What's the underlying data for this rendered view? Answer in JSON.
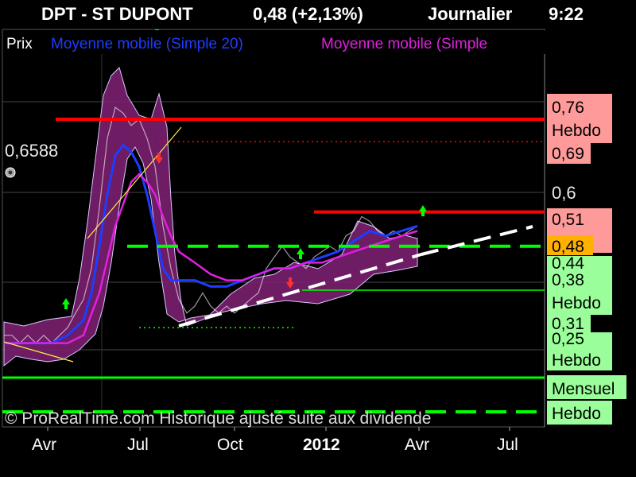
{
  "header": {
    "ticker": "DPT - ST DUPONT",
    "quote": "0,48 (+2,13%)",
    "period": "Journalier",
    "time": "9:22"
  },
  "legend": {
    "price": "Prix",
    "ma1": "Moyenne mobile (Simple 20)",
    "ma2": "Moyenne mobile (Simple"
  },
  "copyright": "© ProRealTime.com Historique ajusté suite aux dividende",
  "cursor_value": "0,6588",
  "colors": {
    "background": "#000000",
    "price_band": "#7a1f6e",
    "ma20": "#1e3cff",
    "ma_magenta": "#e020e0",
    "resistance": "#ff0000",
    "support": "#00ff00",
    "trend": "#ffffff",
    "label_red": "#ff9a9a",
    "label_green": "#9aff9a",
    "label_orange": "#ffb000"
  },
  "chart_data": {
    "type": "line",
    "title": "DPT - ST DUPONT",
    "x_ticks": [
      "Avr",
      "Jul",
      "Oct",
      "2012",
      "Avr",
      "Jul"
    ],
    "y_ticks": [
      "0,6"
    ],
    "y_range": [
      0.2,
      0.9
    ],
    "y_scale": "log",
    "series": [
      {
        "name": "Prix",
        "color": "#ffffff",
        "x": [
          0,
          10,
          20,
          30,
          40,
          50,
          60,
          70,
          80,
          90,
          100,
          110,
          120,
          130,
          140,
          150,
          160,
          170,
          180,
          190,
          200,
          210,
          220,
          230,
          240,
          250,
          260,
          270,
          280,
          290,
          300,
          310,
          320,
          330,
          340,
          350,
          360,
          370,
          380,
          390,
          400,
          410,
          420,
          430,
          440,
          450,
          460,
          470,
          480,
          490,
          500,
          510,
          520
        ],
        "values": [
          0.3,
          0.3,
          0.29,
          0.3,
          0.29,
          0.3,
          0.29,
          0.3,
          0.31,
          0.33,
          0.35,
          0.4,
          0.52,
          0.7,
          0.8,
          0.78,
          0.74,
          0.76,
          0.7,
          0.62,
          0.48,
          0.4,
          0.35,
          0.33,
          0.34,
          0.36,
          0.34,
          0.33,
          0.34,
          0.33,
          0.34,
          0.35,
          0.36,
          0.4,
          0.42,
          0.44,
          0.42,
          0.41,
          0.4,
          0.42,
          0.43,
          0.44,
          0.43,
          0.46,
          0.47,
          0.5,
          0.49,
          0.47,
          0.46,
          0.47,
          0.46,
          0.47,
          0.48
        ]
      },
      {
        "name": "Moyenne mobile (Simple 20)",
        "color": "#1e3cff",
        "x": [
          0,
          20,
          40,
          60,
          80,
          100,
          110,
          120,
          130,
          140,
          150,
          160,
          170,
          180,
          190,
          200,
          210,
          220,
          240,
          260,
          280,
          300,
          320,
          340,
          360,
          380,
          400,
          420,
          440,
          460,
          480,
          500,
          520
        ],
        "values": [
          0.29,
          0.29,
          0.29,
          0.29,
          0.3,
          0.32,
          0.36,
          0.44,
          0.55,
          0.65,
          0.68,
          0.66,
          0.62,
          0.55,
          0.47,
          0.4,
          0.38,
          0.38,
          0.38,
          0.37,
          0.37,
          0.38,
          0.39,
          0.4,
          0.4,
          0.41,
          0.42,
          0.43,
          0.45,
          0.47,
          0.46,
          0.47,
          0.48
        ]
      },
      {
        "name": "Moyenne mobile (Simple",
        "color": "#e020e0",
        "x": [
          0,
          20,
          40,
          60,
          80,
          100,
          120,
          140,
          160,
          170,
          180,
          190,
          200,
          210,
          220,
          240,
          260,
          280,
          300,
          320,
          340,
          360,
          380,
          400,
          420,
          440,
          460,
          480,
          500,
          520
        ],
        "values": [
          0.29,
          0.29,
          0.29,
          0.29,
          0.29,
          0.3,
          0.36,
          0.48,
          0.58,
          0.6,
          0.58,
          0.55,
          0.5,
          0.46,
          0.43,
          0.41,
          0.39,
          0.38,
          0.38,
          0.39,
          0.4,
          0.4,
          0.41,
          0.41,
          0.42,
          0.43,
          0.44,
          0.45,
          0.46,
          0.47
        ]
      }
    ],
    "price_labels": [
      {
        "value": "0,76",
        "note": "Hebdo",
        "color": "#ff9a9a"
      },
      {
        "value": "0,69",
        "color": "#ff9a9a"
      },
      {
        "value": "0,51",
        "color": "#ff9a9a"
      },
      {
        "value": "0,48",
        "color": "#ffb000"
      },
      {
        "value": "0,44",
        "color": "#9aff9a"
      },
      {
        "value": "0,38",
        "note": "Hebdo",
        "color": "#9aff9a"
      },
      {
        "value": "0,31",
        "color": "#9aff9a"
      },
      {
        "value": "0,25",
        "note": "Hebdo",
        "color": "#9aff9a"
      },
      {
        "note": "Mensuel",
        "color": "#9aff9a"
      },
      {
        "note": "Hebdo",
        "color": "#9aff9a"
      }
    ],
    "levels": [
      {
        "value": 0.76,
        "kind": "resistance",
        "style": "solid"
      },
      {
        "value": 0.69,
        "kind": "resistance",
        "style": "dotted"
      },
      {
        "value": 0.51,
        "kind": "resistance",
        "style": "solid"
      },
      {
        "value": 0.44,
        "kind": "support",
        "style": "dashed"
      },
      {
        "value": 0.38,
        "kind": "support",
        "style": "solid"
      },
      {
        "value": 0.31,
        "kind": "support",
        "style": "dotted"
      },
      {
        "value": 0.25,
        "kind": "support",
        "style": "solid"
      },
      {
        "value": 0.22,
        "kind": "support",
        "style": "dashed"
      }
    ],
    "grid": true,
    "legend_placement": "top-left"
  }
}
